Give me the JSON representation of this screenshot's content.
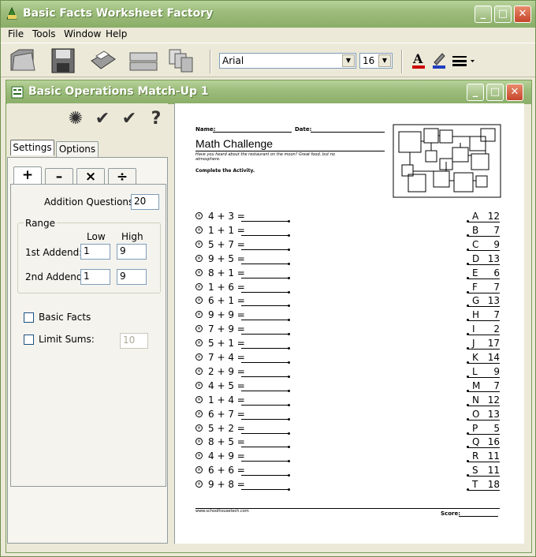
{
  "app": {
    "title": "Basic Facts Worksheet Factory"
  },
  "menu": [
    "File",
    "Tools",
    "Window",
    "Help"
  ],
  "toolbar": {
    "font": "Arial",
    "size": "16",
    "icons": [
      "open-icon",
      "save-icon",
      "print-icon",
      "keyboard-icon",
      "copy-pages-icon"
    ],
    "text_color": "#cc0000",
    "highlight_color": "#1f3fbf"
  },
  "child": {
    "title": "Basic Operations Match-Up 1"
  },
  "panel": {
    "tabs": [
      "Settings",
      "Options"
    ],
    "op_tabs": [
      "+",
      "–",
      "×",
      "÷"
    ],
    "addition_label": "Addition Questions:",
    "addition_value": "20",
    "range_label": "Range",
    "low_label": "Low",
    "high_label": "High",
    "addend1_label": "1st Addend:",
    "addend1_low": "1",
    "addend1_high": "9",
    "addend2_label": "2nd Addend:",
    "addend2_low": "1",
    "addend2_high": "9",
    "basic_facts_label": "Basic Facts",
    "limit_sums_label": "Limit Sums:",
    "limit_sums_value": "10",
    "icons": [
      "wheel-icon",
      "check-icon",
      "double-check-icon",
      "help-icon"
    ]
  },
  "worksheet": {
    "name_label": "Name:",
    "date_label": "Date:",
    "title": "Math Challenge",
    "riddle": "Have you heard about the restaurant on the moon? Great food, but no atmosphere.",
    "instructions": "Complete the Activity.",
    "footer_url": "www.schoolhousetech.com",
    "score_label": "Score:",
    "questions": [
      "4 + 3 =",
      "1 + 1 =",
      "5 + 7 =",
      "9 + 5 =",
      "8 + 1 =",
      "1 + 6 =",
      "6 + 1 =",
      "9 + 9 =",
      "7 + 9 =",
      "5 + 1 =",
      "7 + 4 =",
      "2 + 9 =",
      "4 + 5 =",
      "1 + 4 =",
      "6 + 7 =",
      "5 + 2 =",
      "8 + 5 =",
      "4 + 9 =",
      "6 + 6 =",
      "9 + 8 ="
    ],
    "answers": [
      [
        "A",
        "12"
      ],
      [
        "B",
        "7"
      ],
      [
        "C",
        "9"
      ],
      [
        "D",
        "13"
      ],
      [
        "E",
        "6"
      ],
      [
        "F",
        "7"
      ],
      [
        "G",
        "13"
      ],
      [
        "H",
        "7"
      ],
      [
        "I",
        "2"
      ],
      [
        "J",
        "17"
      ],
      [
        "K",
        "14"
      ],
      [
        "L",
        "9"
      ],
      [
        "M",
        "7"
      ],
      [
        "N",
        "12"
      ],
      [
        "O",
        "13"
      ],
      [
        "P",
        "5"
      ],
      [
        "Q",
        "16"
      ],
      [
        "R",
        "11"
      ],
      [
        "S",
        "11"
      ],
      [
        "T",
        "18"
      ]
    ]
  }
}
